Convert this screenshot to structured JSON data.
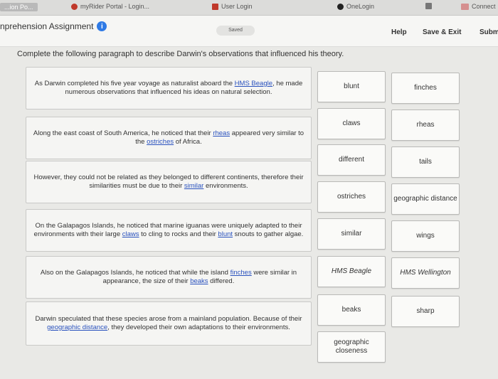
{
  "bookmarks": [
    {
      "label": "...ion Po...",
      "icon": "doc-icon"
    },
    {
      "label": "myRider Portal - Login...",
      "icon": "rider-logo-icon"
    },
    {
      "label": "User Login",
      "icon": "user-login-icon"
    },
    {
      "label": "OneLogin",
      "icon": "onelogin-icon"
    },
    {
      "label": "",
      "icon": "bookmark-icon"
    },
    {
      "label": "Connect",
      "icon": "connect-icon"
    }
  ],
  "header": {
    "title": "nprehension Assignment",
    "saved": "Saved",
    "help": "Help",
    "save_exit": "Save & Exit",
    "submit": "Subm"
  },
  "instructions": "Complete the following paragraph to describe Darwin's observations that influenced his theory.",
  "paragraphs": [
    {
      "pre": "As Darwin completed his five year voyage as naturalist aboard the ",
      "b1": "HMS Beagle",
      "mid": ", he made numerous observations that influenced his ideas on natural selection.",
      "b2": "",
      "post": ""
    },
    {
      "pre": "Along the east coast of South America, he noticed that their ",
      "b1": "rheas",
      "mid": " appeared very similar to the ",
      "b2": "ostriches",
      "post": " of Africa."
    },
    {
      "pre": "However, they could not be related as they belonged to different continents, therefore their similarities must be due to their ",
      "b1": "similar",
      "mid": " environments.",
      "b2": "",
      "post": ""
    },
    {
      "pre": "On the Galapagos Islands, he noticed that marine iguanas were uniquely adapted to their environments with their large ",
      "b1": "claws",
      "mid": " to cling to rocks and their ",
      "b2": "blunt",
      "post": " snouts to gather algae."
    },
    {
      "pre": "Also on the Galapagos Islands, he noticed that while the island ",
      "b1": "finches",
      "mid": " were similar in appearance, the size of their ",
      "b2": "beaks",
      "post": " differed."
    },
    {
      "pre": "Darwin speculated that these species arose from a mainland population. Because of their ",
      "b1": "geographic distance",
      "mid": ", they developed their own adaptations to their environments.",
      "b2": "",
      "post": ""
    }
  ],
  "word_bank": [
    "blunt",
    "finches",
    "claws",
    "rheas",
    "different",
    "tails",
    "ostriches",
    "geographic distance",
    "similar",
    "wings",
    "HMS Beagle",
    "HMS Wellington",
    "beaks",
    "sharp",
    "geographic closeness"
  ]
}
